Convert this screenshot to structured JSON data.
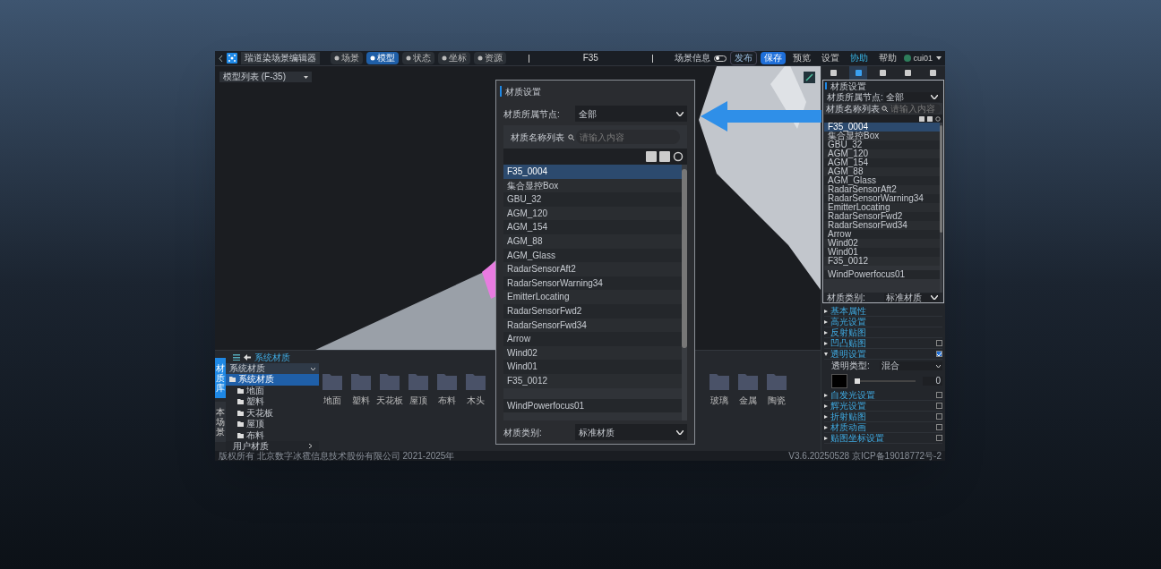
{
  "app": {
    "title": "瑞道染场景编辑器",
    "tabs": [
      {
        "label": "场景",
        "selected": false
      },
      {
        "label": "模型",
        "selected": true
      },
      {
        "label": "状态",
        "selected": false
      },
      {
        "label": "坐标",
        "selected": false
      },
      {
        "label": "资源",
        "selected": false
      }
    ],
    "document": "F35",
    "scene_info": {
      "label": "场景信息",
      "on": false
    },
    "actions": [
      {
        "kind": "dropdown",
        "label": "发布"
      },
      {
        "kind": "primary",
        "label": "保存"
      },
      {
        "kind": "plain",
        "label": "预览"
      },
      {
        "kind": "plain",
        "label": "设置"
      },
      {
        "kind": "accent",
        "label": "协助"
      },
      {
        "kind": "plain",
        "label": "帮助"
      }
    ],
    "user": "cui01"
  },
  "viewport": {
    "model_list": "模型列表 (F-35)"
  },
  "right_panel": {
    "tabs": [
      {
        "selected": false
      },
      {
        "selected": true
      },
      {
        "selected": false
      },
      {
        "selected": false
      },
      {
        "selected": false
      }
    ],
    "title": "材质设置",
    "node_label": "材质所属节点:",
    "node_value": "全部",
    "list_label": "材质名称列表",
    "search_placeholder": "请输入内容",
    "materials": [
      {
        "name": "F35_0004",
        "selected": true
      },
      {
        "name": "集合显控Box",
        "selected": false
      },
      {
        "name": "GBU_32",
        "selected": false
      },
      {
        "name": "AGM_120",
        "selected": false
      },
      {
        "name": "AGM_154",
        "selected": false
      },
      {
        "name": "AGM_88",
        "selected": false
      },
      {
        "name": "AGM_Glass",
        "selected": false
      },
      {
        "name": "RadarSensorAft2",
        "selected": false
      },
      {
        "name": "RadarSensorWarning34",
        "selected": false
      },
      {
        "name": "EmitterLocating",
        "selected": false
      },
      {
        "name": "RadarSensorFwd2",
        "selected": false
      },
      {
        "name": "RadarSensorFwd34",
        "selected": false
      },
      {
        "name": "Arrow",
        "selected": false
      },
      {
        "name": "Wind02",
        "selected": false
      },
      {
        "name": "Wind01",
        "selected": false
      },
      {
        "name": "F35_0012",
        "selected": false
      },
      {
        "name": "WindPowerfocus01",
        "selected": false
      }
    ],
    "type_label": "材质类别:",
    "type_value": "标准材质",
    "sections": [
      {
        "label": "基本属性",
        "expanded": false
      },
      {
        "label": "高光设置",
        "expanded": false
      },
      {
        "label": "反射贴图",
        "expanded": false
      },
      {
        "label": "凹凸贴图",
        "expanded": false,
        "checked": false
      },
      {
        "label": "透明设置",
        "expanded": true,
        "checked": true,
        "type_label": "透明类型:",
        "type_value": "混合",
        "value": "0",
        "level": 0
      },
      {
        "label": "自发光设置",
        "expanded": false,
        "checked": false
      },
      {
        "label": "辉光设置",
        "expanded": false,
        "checked": false
      },
      {
        "label": "折射贴图",
        "expanded": false,
        "checked": false
      },
      {
        "label": "材质动画",
        "expanded": false,
        "checked": false
      },
      {
        "label": "贴图坐标设置",
        "expanded": false,
        "checked": false
      }
    ]
  },
  "material_library": {
    "side_tabs": [
      {
        "label": "材质库",
        "selected": true
      },
      {
        "label": "本场景",
        "selected": false
      }
    ],
    "breadcrumb": "系统材质",
    "dropdown": "系统材质",
    "tree": [
      {
        "label": "系统材质",
        "selected": true,
        "expanded": true,
        "children": [
          {
            "label": "地面"
          },
          {
            "label": "塑料"
          },
          {
            "label": "天花板"
          },
          {
            "label": "屋顶"
          },
          {
            "label": "布料"
          }
        ]
      }
    ],
    "user_materials": "用户材质",
    "folders": [
      "地面",
      "塑料",
      "天花板",
      "屋顶",
      "布料",
      "木头"
    ],
    "folders_right": [
      "玻璃",
      "金属",
      "陶瓷"
    ]
  },
  "footer": {
    "copyright": "版权所有 北京数字冰雹信息技术股份有限公司 2021-2025年",
    "version": "V3.6.20250528 京ICP备19018772号-2"
  },
  "callout": {
    "title": "材质设置",
    "node_label": "材质所属节点:",
    "node_value": "全部",
    "list_label": "材质名称列表",
    "search_placeholder": "请输入内容",
    "materials": [
      {
        "name": "F35_0004",
        "selected": true
      },
      {
        "name": "集合显控Box",
        "selected": false
      },
      {
        "name": "GBU_32",
        "selected": false
      },
      {
        "name": "AGM_120",
        "selected": false
      },
      {
        "name": "AGM_154",
        "selected": false
      },
      {
        "name": "AGM_88",
        "selected": false
      },
      {
        "name": "AGM_Glass",
        "selected": false
      },
      {
        "name": "RadarSensorAft2",
        "selected": false
      },
      {
        "name": "RadarSensorWarning34",
        "selected": false
      },
      {
        "name": "EmitterLocating",
        "selected": false
      },
      {
        "name": "RadarSensorFwd2",
        "selected": false
      },
      {
        "name": "RadarSensorFwd34",
        "selected": false
      },
      {
        "name": "Arrow",
        "selected": false
      },
      {
        "name": "Wind02",
        "selected": false
      },
      {
        "name": "Wind01",
        "selected": false
      },
      {
        "name": "F35_0012",
        "selected": false
      },
      {
        "name": "WindPowerfocus01",
        "selected": false
      }
    ],
    "type_label": "材质类别:",
    "type_value": "标准材质"
  }
}
